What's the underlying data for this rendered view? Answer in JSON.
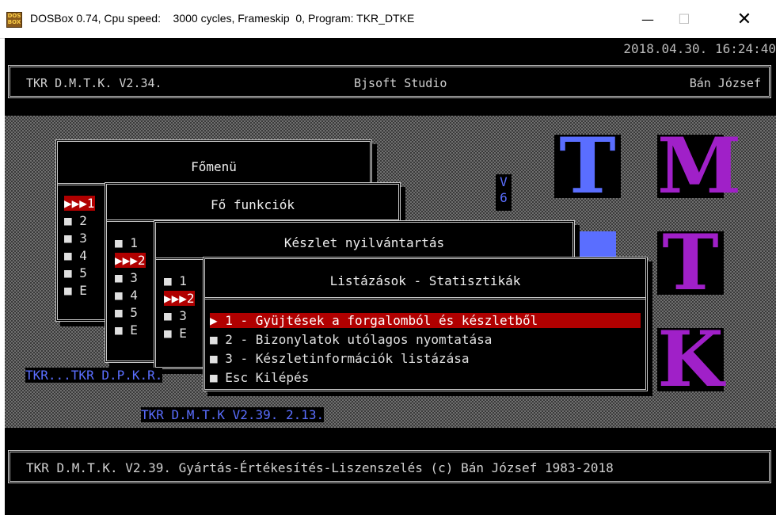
{
  "window": {
    "title": "DOSBox 0.74, Cpu speed:    3000 cycles, Frameskip  0, Program: TKR_DTKE",
    "icon_text": "DOS BOX",
    "min": "—",
    "max": "☐",
    "close": "✕"
  },
  "clock": "2018.04.30. 16:24:40",
  "header": {
    "left": "TKR D.M.T.K. V2.34.",
    "center": "Bjsoft Studio",
    "right": "Bán József"
  },
  "footer": "TKR D.M.T.K. V2.39. Gyártás-Értékesítés-Liszenszelés (c) Bán József 1983-2018",
  "logo": {
    "l1": "T",
    "l2": "M",
    "l3": "T",
    "l4": "K",
    "color_blue": "#5a6eff",
    "color_magenta": "#a020c8"
  },
  "vbox": {
    "a": "V",
    "b": "6"
  },
  "menus": {
    "fomenu": {
      "title": "Főmenü",
      "items": [
        "▶▶▶1",
        "■ 2",
        "■ 3",
        "■ 4",
        "■ 5",
        "■ E"
      ]
    },
    "fofunkciok": {
      "title": "Fő funkciók",
      "items": [
        "■ 1",
        "▶▶▶2",
        "■ 3",
        "■ 4",
        "■ 5",
        "■ E"
      ]
    },
    "keszlet": {
      "title": "Készlet nyilvántartás",
      "items": [
        "■ 1",
        "▶▶▶2",
        "■ 3",
        "■ E"
      ]
    },
    "listazasok": {
      "title": "Listázások - Statisztikák",
      "items": [
        "▶ 1 - Gyüjtések a forgalomból és készletből",
        "■ 2 - Bizonylatok utólagos nyomtatása",
        "■ 3 - Készletinformációk listázása",
        "■ Esc Kilépés"
      ]
    }
  },
  "blue_labels": {
    "a": "TKR...TKR D.P.K.R.",
    "b": "TKR D.M.T.K V2.39. 2.13."
  }
}
